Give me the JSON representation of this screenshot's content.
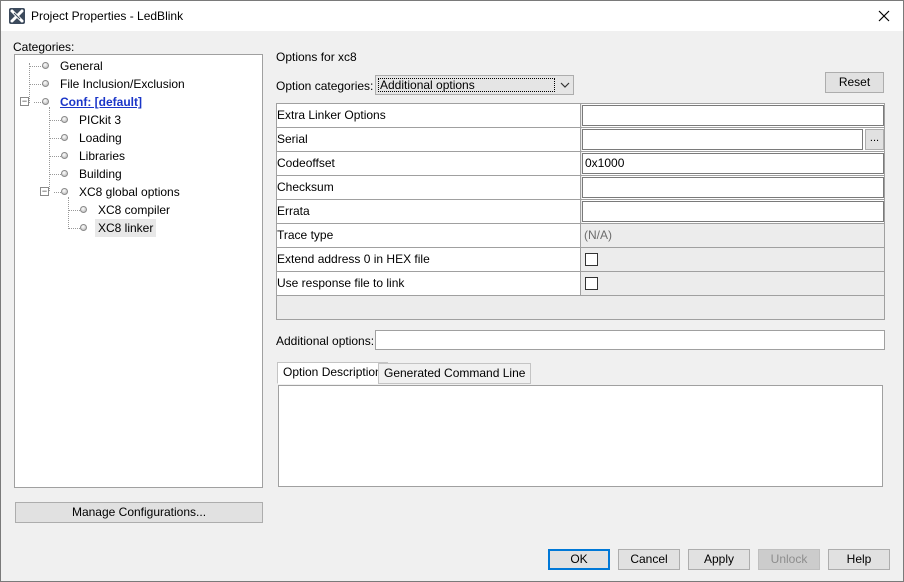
{
  "window": {
    "title": "Project Properties - LedBlink",
    "close_glyph": "✕"
  },
  "categories": {
    "label": "Categories:",
    "tree": [
      {
        "label": "General"
      },
      {
        "label": "File Inclusion/Exclusion"
      },
      {
        "label": "Conf: [default]"
      },
      {
        "label": "PICkit 3"
      },
      {
        "label": "Loading"
      },
      {
        "label": "Libraries"
      },
      {
        "label": "Building"
      },
      {
        "label": "XC8 global options"
      },
      {
        "label": "XC8 compiler"
      },
      {
        "label": "XC8 linker"
      }
    ],
    "expander_glyph": "−"
  },
  "manage_button": "Manage Configurations...",
  "options": {
    "header": "Options for xc8",
    "category_label": "Option categories:",
    "category_value": "Additional options",
    "reset_label": "Reset"
  },
  "grid": {
    "rows": [
      {
        "name": "Extra Linker Options",
        "value": ""
      },
      {
        "name": "Serial",
        "value": "",
        "button": "..."
      },
      {
        "name": "Codeoffset",
        "value": "0x1000"
      },
      {
        "name": "Checksum",
        "value": ""
      },
      {
        "name": "Errata",
        "value": ""
      },
      {
        "name": "Trace type",
        "value": "(N/A)"
      },
      {
        "name": "Extend address 0 in HEX file",
        "checked": false
      },
      {
        "name": "Use response file to link",
        "checked": false
      }
    ]
  },
  "additional": {
    "label": "Additional options:",
    "value": ""
  },
  "tabs": [
    {
      "label": "Option Description",
      "active": true
    },
    {
      "label": "Generated Command Line",
      "active": false
    }
  ],
  "footer": {
    "ok": "OK",
    "cancel": "Cancel",
    "apply": "Apply",
    "unlock": "Unlock",
    "help": "Help"
  },
  "colors": {
    "link": "#1a35c8",
    "accent": "#0078d7"
  }
}
